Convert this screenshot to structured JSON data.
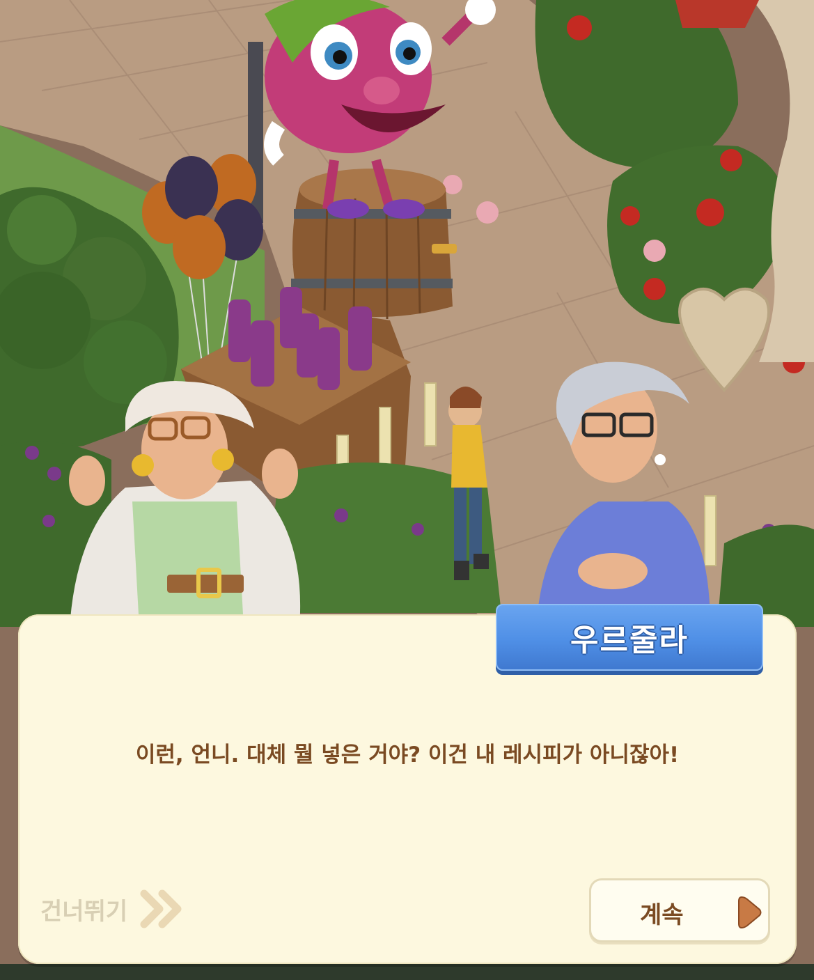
{
  "dialog": {
    "speaker": "우르줄라",
    "message": "이런, 언니. 대체 뭘 넣은 거야? 이건 내 레시피가 아니잖아!",
    "skip_label": "건너뛰기",
    "continue_label": "계속"
  },
  "icons": {
    "skip": "double-chevron-right-icon",
    "continue": "play-triangle-icon"
  },
  "colors": {
    "dialog_bg": "#fdf8df",
    "name_tag": "#4f8fe6",
    "dialog_text": "#7a4a22",
    "skip_text": "#d8cfb4",
    "continue_arrow": "#c87a45"
  }
}
